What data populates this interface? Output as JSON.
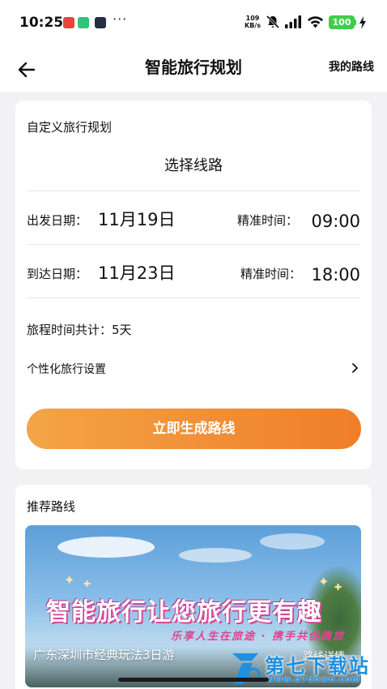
{
  "status_bar": {
    "time": "10:25",
    "dots": "···",
    "net_speed_value": "109",
    "net_speed_unit": "KB/s",
    "battery": "100",
    "icons": [
      "app-notification-icon",
      "wechat-icon",
      "app-icon",
      "mute-icon",
      "signal-icon",
      "wifi-icon",
      "battery-icon",
      "charging-icon"
    ],
    "battery_color": "#3fce4c"
  },
  "nav": {
    "title": "智能旅行规划",
    "right_link": "我的路线",
    "back_icon": "back-arrow-icon"
  },
  "plan": {
    "heading": "自定义旅行规划",
    "select_route": "选择线路",
    "departure": {
      "label": "出发日期：",
      "date": "11月19日",
      "time_label": "精准时间：",
      "time": "09:00"
    },
    "arrival": {
      "label": "到达日期：",
      "date": "11月23日",
      "time_label": "精准时间：",
      "time": "18:00"
    },
    "duration": "旅程时间共计：5天",
    "personalize": "个性化旅行设置",
    "generate_button": "立即生成路线",
    "button_gradient": [
      "#f3a446",
      "#f07e28"
    ]
  },
  "recommended": {
    "heading": "推荐路线",
    "card": {
      "slogan": "智能旅行让您旅行更有趣",
      "sub_slogan": "乐享人生在旅途 · 携手共创趣旅",
      "title": "广东深圳市经典玩法3日游",
      "tag": "路线详情"
    }
  },
  "watermark": {
    "name": "第七下载站",
    "url": "www.d7down.com"
  }
}
